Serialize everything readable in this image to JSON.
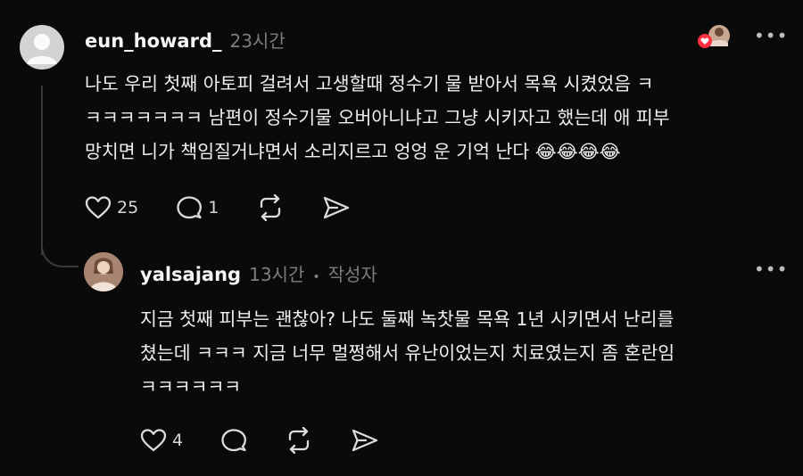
{
  "comment": {
    "username": "eun_howard_",
    "time": "23시간",
    "lines": [
      "나도 우리 첫째 아토피 걸려서 고생할때 정수기 물 받아서 목욕 시켰었음 ㅋ",
      "ㅋㅋㅋㅋㅋㅋㅋ 남편이 정수기물 오버아니냐고 그냥 시키자고 했는데 애 피부",
      "망치면 니가 책임질거냐면서 소리지르고 엉엉 운 기억 난다"
    ],
    "emoji": "😂😂😂😂",
    "likes": "25",
    "replies": "1",
    "more": "•••"
  },
  "reply": {
    "username": "yalsajang",
    "time": "13시간",
    "separator": "•",
    "author_tag": "작성자",
    "lines": [
      "지금 첫째 피부는 괜찮아? 나도 둘째 녹찻물 목욕 1년 시키면서 난리를",
      "쳤는데 ㅋㅋㅋ 지금 너무 멀쩡해서 유난이었는지 치료였는지 좀 혼란임",
      "ㅋㅋㅋㅋㅋㅋ"
    ],
    "likes": "4",
    "more": "•••"
  },
  "colors": {
    "background": "#0a0a0a",
    "text": "#efefef",
    "muted": "#7d7d7d",
    "heart_badge": "#ff3040"
  },
  "icons": [
    "heart-icon",
    "comment-icon",
    "repost-icon",
    "share-icon",
    "more-icon",
    "default-avatar-icon"
  ]
}
